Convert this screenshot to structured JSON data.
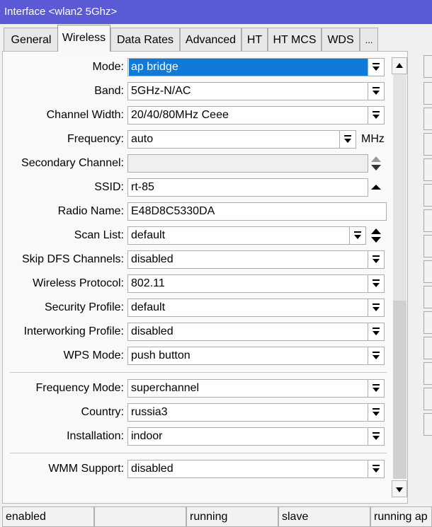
{
  "window": {
    "title": "Interface <wlan2 5Ghz>"
  },
  "tabs": [
    {
      "label": "General"
    },
    {
      "label": "Wireless"
    },
    {
      "label": "Data Rates"
    },
    {
      "label": "Advanced"
    },
    {
      "label": "HT"
    },
    {
      "label": "HT MCS"
    },
    {
      "label": "WDS"
    },
    {
      "label": "..."
    }
  ],
  "active_tab": "Wireless",
  "form": {
    "mode": {
      "label": "Mode:",
      "value": "ap bridge"
    },
    "band": {
      "label": "Band:",
      "value": "5GHz-N/AC"
    },
    "channel_width": {
      "label": "Channel Width:",
      "value": "20/40/80MHz Ceee"
    },
    "frequency": {
      "label": "Frequency:",
      "value": "auto",
      "unit": "MHz"
    },
    "secondary_channel": {
      "label": "Secondary Channel:",
      "value": ""
    },
    "ssid": {
      "label": "SSID:",
      "value": "rt-85"
    },
    "radio_name": {
      "label": "Radio Name:",
      "value": "E48D8C5330DA"
    },
    "scan_list": {
      "label": "Scan List:",
      "value": "default"
    },
    "skip_dfs": {
      "label": "Skip DFS Channels:",
      "value": "disabled"
    },
    "wireless_protocol": {
      "label": "Wireless Protocol:",
      "value": "802.11"
    },
    "security_profile": {
      "label": "Security Profile:",
      "value": "default"
    },
    "interworking_profile": {
      "label": "Interworking Profile:",
      "value": "disabled"
    },
    "wps_mode": {
      "label": "WPS Mode:",
      "value": "push button"
    },
    "frequency_mode": {
      "label": "Frequency Mode:",
      "value": "superchannel"
    },
    "country": {
      "label": "Country:",
      "value": "russia3"
    },
    "installation": {
      "label": "Installation:",
      "value": "indoor"
    },
    "wmm_support": {
      "label": "WMM Support:",
      "value": "disabled"
    }
  },
  "status_bar": [
    "enabled",
    "",
    "running",
    "slave",
    "running ap"
  ],
  "colors": {
    "titlebar": "#5a5ad6",
    "selection": "#0f7ad8"
  }
}
